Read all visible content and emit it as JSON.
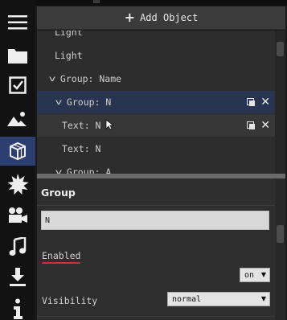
{
  "toolbar": {
    "add_object_label": "Add Object"
  },
  "sidebar": {
    "items": [
      {
        "icon": "menu-icon"
      },
      {
        "icon": "folder-icon"
      },
      {
        "icon": "checkbox-icon"
      },
      {
        "icon": "image-icon"
      },
      {
        "icon": "cube-icon",
        "active": true
      },
      {
        "icon": "burst-icon"
      },
      {
        "icon": "camera-icon"
      },
      {
        "icon": "music-note-icon"
      },
      {
        "icon": "download-icon"
      },
      {
        "icon": "info-icon"
      }
    ]
  },
  "tree": {
    "items": [
      {
        "label": "Light"
      },
      {
        "label": "Light"
      },
      {
        "label": "Group: Name",
        "expanded": true
      },
      {
        "label": "Group: N",
        "expanded": true,
        "selected": true
      },
      {
        "label": "Text: N"
      },
      {
        "label": "Text: N"
      },
      {
        "label": "Group: A",
        "expanded": true
      }
    ]
  },
  "properties": {
    "title": "Group",
    "name_value": "N",
    "enabled_label": "Enabled",
    "enabled_value": "on",
    "visibility_label": "Visibility",
    "visibility_value": "normal"
  },
  "colors": {
    "selection": "#283450",
    "sidebar_active": "#2c3f70",
    "error_underline": "#c23a32"
  }
}
